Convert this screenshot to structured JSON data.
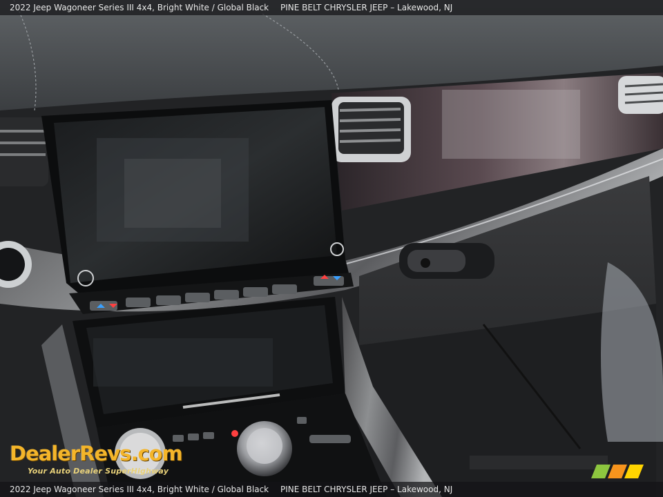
{
  "caption": {
    "vehicle": "2022 Jeep Wagoneer Series III 4x4,  Bright White / Global Black",
    "dealer": "PINE BELT CHRYSLER JEEP – Lakewood, NJ"
  },
  "watermark": {
    "brand": "DealerRevs.com",
    "tagline": "Your Auto Dealer SuperHighway"
  },
  "colors": {
    "accent": "#f4b52a",
    "stripe_green": "#8dc63f",
    "stripe_orange": "#f7941d",
    "stripe_yellow": "#ffd400"
  }
}
